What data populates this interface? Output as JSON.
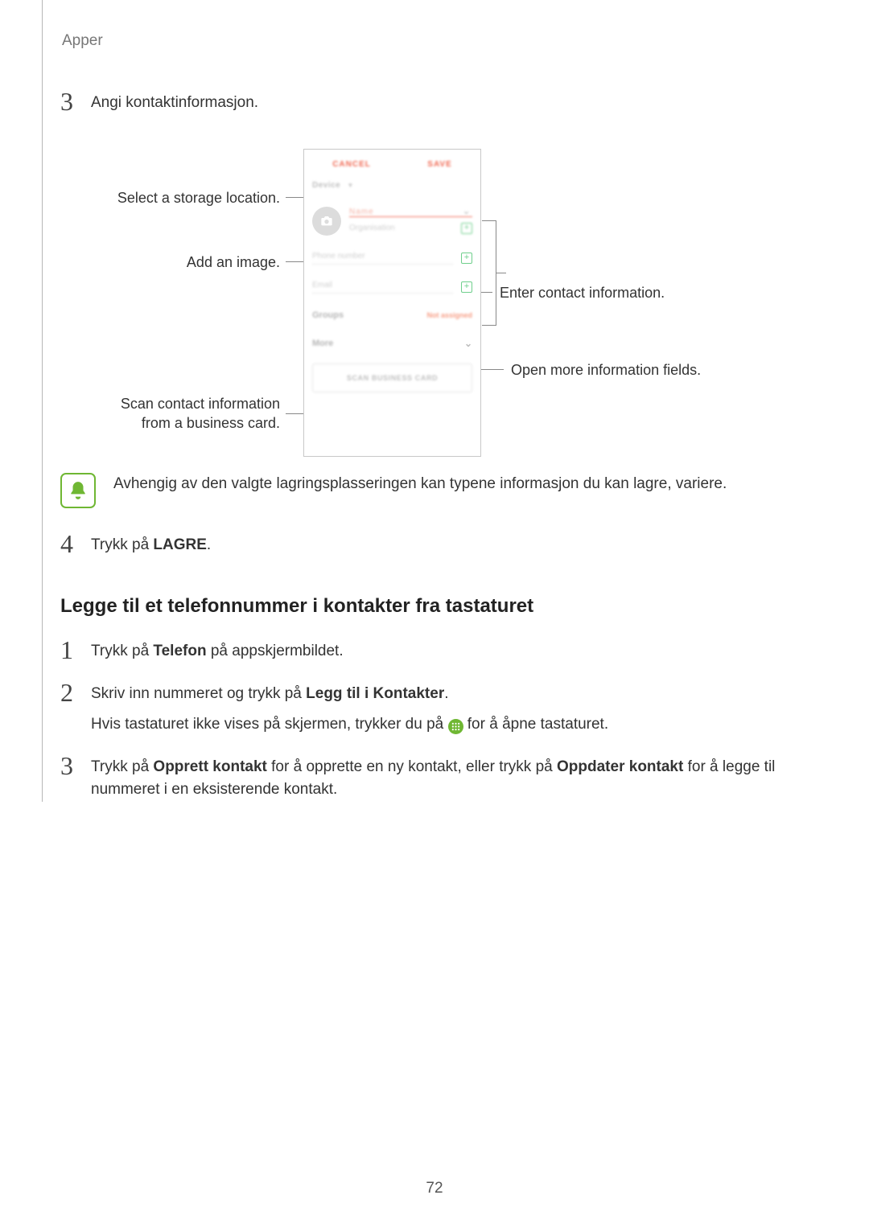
{
  "header": {
    "title": "Apper"
  },
  "step3": {
    "text": "Angi kontaktinformasjon."
  },
  "callouts": {
    "left": {
      "storage": "Select a storage location.",
      "image": "Add an image.",
      "scan": "Scan contact information from a business card."
    },
    "right": {
      "enter": "Enter contact information.",
      "more": "Open more information fields."
    }
  },
  "phone": {
    "cancel": "CANCEL",
    "save": "SAVE",
    "storage": "Device",
    "name": "Name",
    "organisation": "Organisation",
    "phonenumber": "Phone number",
    "email": "Email",
    "groups_label": "Groups",
    "groups_value": "Not assigned",
    "more": "More",
    "scan": "SCAN BUSINESS CARD"
  },
  "note": {
    "text": "Avhengig av den valgte lagringsplasseringen kan typene informasjon du kan lagre, variere."
  },
  "step4": {
    "pre": "Trykk på ",
    "bold": "LAGRE",
    "post": "."
  },
  "h2": "Legge til et telefonnummer i kontakter fra tastaturet",
  "b_step1": {
    "pre": "Trykk på ",
    "bold": "Telefon",
    "post": " på appskjermbildet."
  },
  "b_step2": {
    "line1_pre": "Skriv inn nummeret og trykk på ",
    "line1_bold": "Legg til i Kontakter",
    "line1_post": ".",
    "line2_pre": "Hvis tastaturet ikke vises på skjermen, trykker du på ",
    "line2_post": " for å åpne tastaturet."
  },
  "b_step3": {
    "pre": "Trykk på ",
    "b1": "Opprett kontakt",
    "mid": " for å opprette en ny kontakt, eller trykk på ",
    "b2": "Oppdater kontakt",
    "post": " for å legge til nummeret i en eksisterende kontakt."
  },
  "page_number": "72"
}
